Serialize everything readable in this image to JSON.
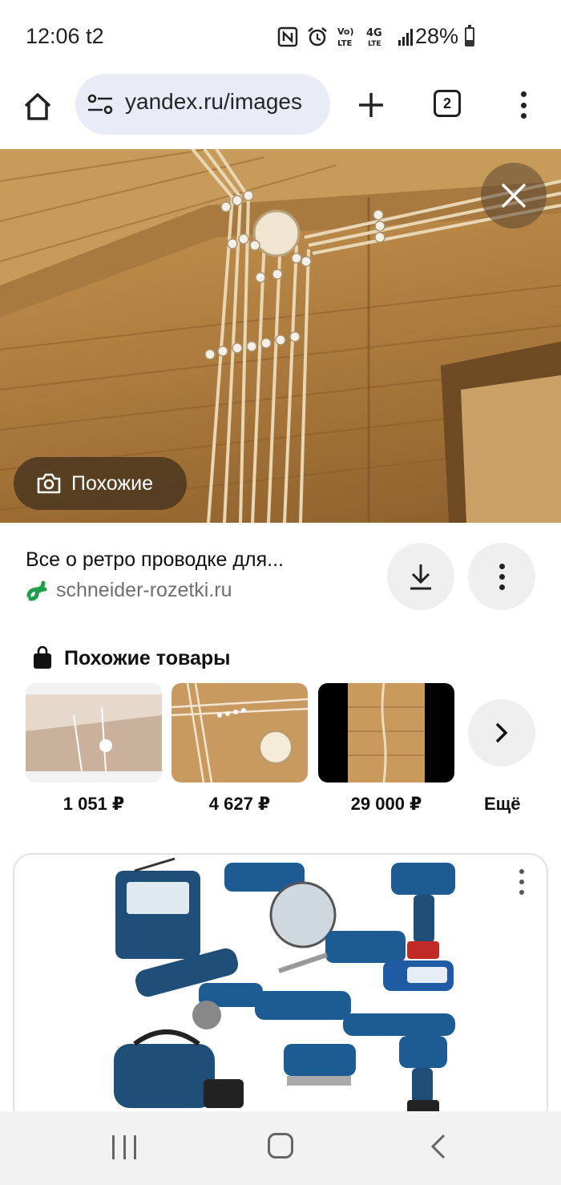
{
  "status_bar": {
    "time": "12:06 t2",
    "battery_percent": "28%",
    "volte_label": "Vo)\nLTE",
    "network_label": "4G"
  },
  "browser": {
    "url": "yandex.ru/images",
    "tab_count": "2"
  },
  "hero": {
    "similar_label": "Похожие"
  },
  "result": {
    "title": "Все о ретро проводке для...",
    "source": "schneider-rozetki.ru"
  },
  "products": {
    "section_title": "Похожие товары",
    "items": [
      {
        "price": "1 051 ₽"
      },
      {
        "price": "4 627 ₽"
      },
      {
        "price": "29 000 ₽"
      }
    ],
    "more_label": "Ещё"
  },
  "colors": {
    "accent_source_icon": "#1e9f4a",
    "url_pill": "#e7ecf6"
  }
}
